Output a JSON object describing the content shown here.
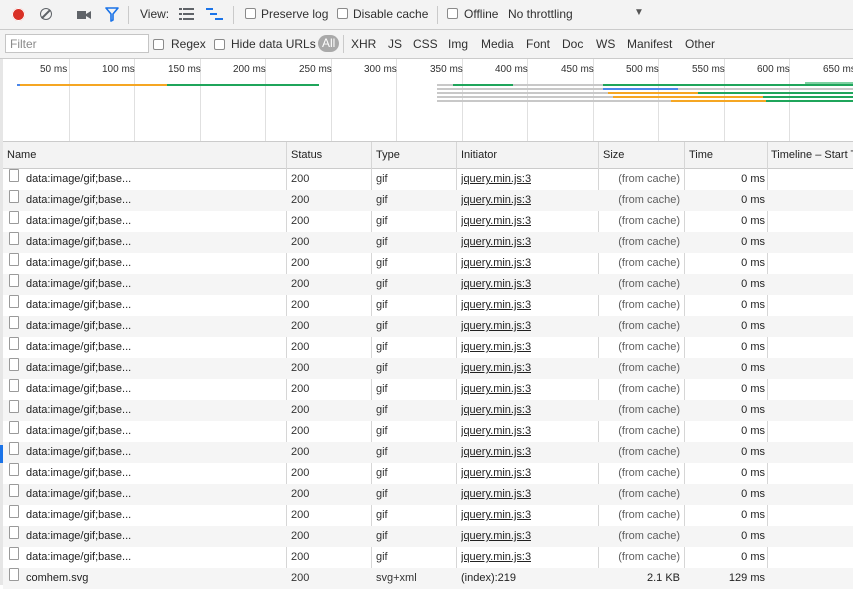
{
  "toolbar": {
    "view_label": "View:",
    "preserve_log": "Preserve log",
    "disable_cache": "Disable cache",
    "offline": "Offline",
    "throttling": "No throttling",
    "throttling_arrow": "▼"
  },
  "filterbar": {
    "placeholder": "Filter",
    "regex": "Regex",
    "hide_data_urls": "Hide data URLs",
    "all": "All",
    "types": [
      "XHR",
      "JS",
      "CSS",
      "Img",
      "Media",
      "Font",
      "Doc",
      "WS",
      "Manifest",
      "Other"
    ]
  },
  "overview": {
    "ticks": [
      "50 ms",
      "100 ms",
      "150 ms",
      "200 ms",
      "250 ms",
      "300 ms",
      "350 ms",
      "400 ms",
      "450 ms",
      "500 ms",
      "550 ms",
      "600 ms",
      "650 ms"
    ]
  },
  "columns": [
    "Name",
    "Status",
    "Type",
    "Initiator",
    "Size",
    "Time",
    "Timeline – Start Time"
  ],
  "rows": [
    {
      "name": "data:image/gif;base...",
      "status": "200",
      "type": "gif",
      "initiator": "jquery.min.js:3",
      "size": "(from cache)",
      "time": "0 ms"
    },
    {
      "name": "data:image/gif;base...",
      "status": "200",
      "type": "gif",
      "initiator": "jquery.min.js:3",
      "size": "(from cache)",
      "time": "0 ms"
    },
    {
      "name": "data:image/gif;base...",
      "status": "200",
      "type": "gif",
      "initiator": "jquery.min.js:3",
      "size": "(from cache)",
      "time": "0 ms"
    },
    {
      "name": "data:image/gif;base...",
      "status": "200",
      "type": "gif",
      "initiator": "jquery.min.js:3",
      "size": "(from cache)",
      "time": "0 ms"
    },
    {
      "name": "data:image/gif;base...",
      "status": "200",
      "type": "gif",
      "initiator": "jquery.min.js:3",
      "size": "(from cache)",
      "time": "0 ms"
    },
    {
      "name": "data:image/gif;base...",
      "status": "200",
      "type": "gif",
      "initiator": "jquery.min.js:3",
      "size": "(from cache)",
      "time": "0 ms"
    },
    {
      "name": "data:image/gif;base...",
      "status": "200",
      "type": "gif",
      "initiator": "jquery.min.js:3",
      "size": "(from cache)",
      "time": "0 ms"
    },
    {
      "name": "data:image/gif;base...",
      "status": "200",
      "type": "gif",
      "initiator": "jquery.min.js:3",
      "size": "(from cache)",
      "time": "0 ms"
    },
    {
      "name": "data:image/gif;base...",
      "status": "200",
      "type": "gif",
      "initiator": "jquery.min.js:3",
      "size": "(from cache)",
      "time": "0 ms"
    },
    {
      "name": "data:image/gif;base...",
      "status": "200",
      "type": "gif",
      "initiator": "jquery.min.js:3",
      "size": "(from cache)",
      "time": "0 ms"
    },
    {
      "name": "data:image/gif;base...",
      "status": "200",
      "type": "gif",
      "initiator": "jquery.min.js:3",
      "size": "(from cache)",
      "time": "0 ms"
    },
    {
      "name": "data:image/gif;base...",
      "status": "200",
      "type": "gif",
      "initiator": "jquery.min.js:3",
      "size": "(from cache)",
      "time": "0 ms"
    },
    {
      "name": "data:image/gif;base...",
      "status": "200",
      "type": "gif",
      "initiator": "jquery.min.js:3",
      "size": "(from cache)",
      "time": "0 ms"
    },
    {
      "name": "data:image/gif;base...",
      "status": "200",
      "type": "gif",
      "initiator": "jquery.min.js:3",
      "size": "(from cache)",
      "time": "0 ms"
    },
    {
      "name": "data:image/gif;base...",
      "status": "200",
      "type": "gif",
      "initiator": "jquery.min.js:3",
      "size": "(from cache)",
      "time": "0 ms"
    },
    {
      "name": "data:image/gif;base...",
      "status": "200",
      "type": "gif",
      "initiator": "jquery.min.js:3",
      "size": "(from cache)",
      "time": "0 ms"
    },
    {
      "name": "data:image/gif;base...",
      "status": "200",
      "type": "gif",
      "initiator": "jquery.min.js:3",
      "size": "(from cache)",
      "time": "0 ms"
    },
    {
      "name": "data:image/gif;base...",
      "status": "200",
      "type": "gif",
      "initiator": "jquery.min.js:3",
      "size": "(from cache)",
      "time": "0 ms"
    },
    {
      "name": "data:image/gif;base...",
      "status": "200",
      "type": "gif",
      "initiator": "jquery.min.js:3",
      "size": "(from cache)",
      "time": "0 ms"
    },
    {
      "name": "comhem.svg",
      "status": "200",
      "type": "svg+xml",
      "initiator": "(index):219",
      "size": "2.1 KB",
      "time": "129 ms"
    }
  ],
  "colors": {
    "record": "#d93025",
    "filter_active": "#1a73e8",
    "waiting": "#f5a623",
    "receiving": "#1fa55b"
  }
}
